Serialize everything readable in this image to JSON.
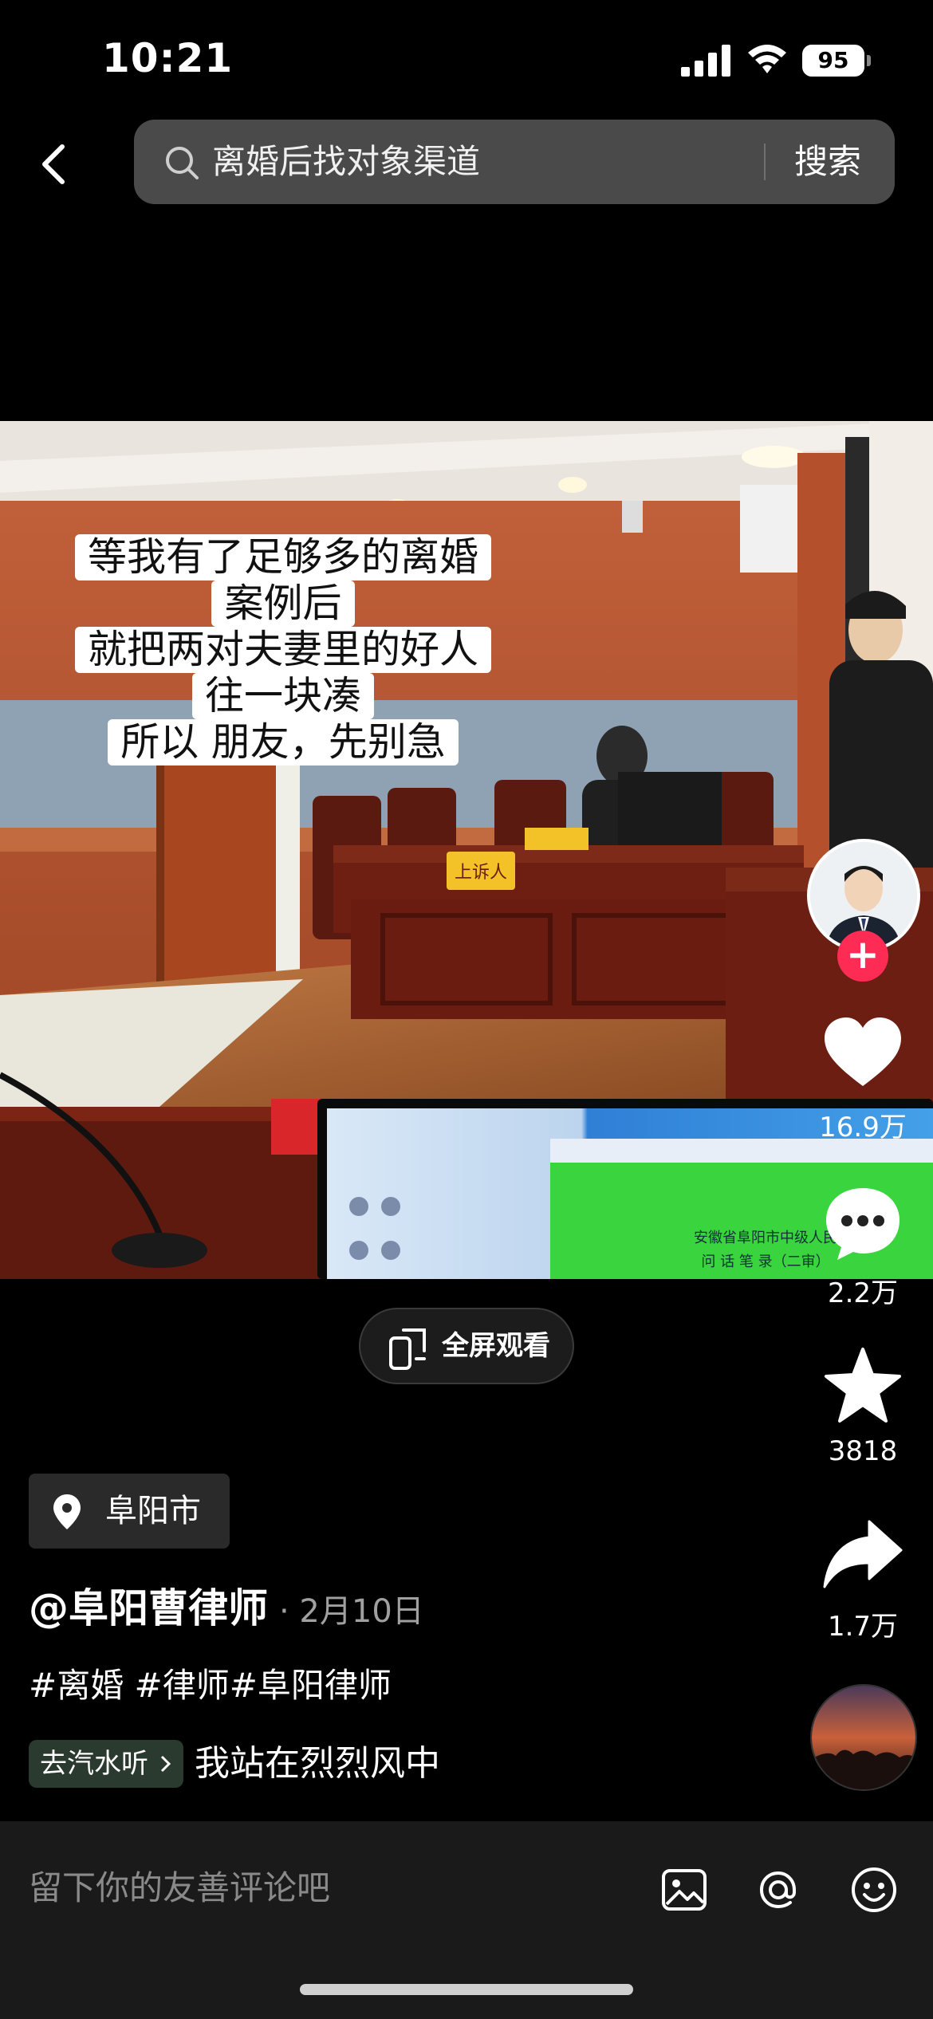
{
  "status_bar": {
    "time": "10:21",
    "battery": "95"
  },
  "search": {
    "query": "离婚后找对象渠道",
    "button_label": "搜索"
  },
  "video": {
    "caption_lines": [
      "等我有了足够多的离婚",
      "案例后",
      "就把两对夫妻里的好人",
      "往一块凑",
      "所以 朋友，先别急"
    ],
    "signs": {
      "appellant": "上诉人",
      "screen_title": "安徽省阜阳市中级人民",
      "screen_subtitle": "问 话 笔 录（二审）"
    }
  },
  "actions": {
    "follow_label": "+",
    "likes": "16.9万",
    "comments": "2.2万",
    "favorites": "3818",
    "shares": "1.7万"
  },
  "fullscreen": {
    "label": "全屏观看"
  },
  "location": {
    "label": "阜阳市"
  },
  "author": {
    "name": "@阜阳曹律师",
    "date": "· 2月10日"
  },
  "hashtags": "#离婚 #律师#阜阳律师",
  "music": {
    "link_label": "去汽水听",
    "title": "我站在烈烈风中"
  },
  "comment": {
    "placeholder": "留下你的友善评论吧"
  },
  "colors": {
    "accent_red": "#fe2c55",
    "background": "#000000",
    "search_bg": "#4a4a4a"
  },
  "icons": [
    "back-icon",
    "search-icon",
    "signal-icon",
    "wifi-icon",
    "battery-icon",
    "heart-icon",
    "comment-icon",
    "star-icon",
    "share-icon",
    "location-pin-icon",
    "fullscreen-icon",
    "image-icon",
    "at-icon",
    "emoji-icon"
  ]
}
